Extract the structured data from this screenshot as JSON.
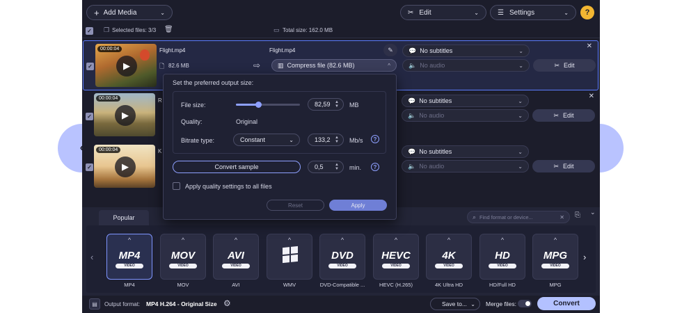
{
  "header": {
    "add_media": "Add Media",
    "edit": "Edit",
    "settings": "Settings",
    "help": "?"
  },
  "toolbar": {
    "selected_files": "Selected files: 3/3",
    "total_size": "Total size: 162.0 MB"
  },
  "files": [
    {
      "duration": "00:00:04",
      "name": "Flight.mp4",
      "size": "82.6 MB",
      "output_name": "Flight.mp4",
      "compress": "Compress file (82.6 MB)",
      "subtitles": "No subtitles",
      "audio": "No audio",
      "edit": "Edit"
    },
    {
      "duration": "00:00:04",
      "name": "R",
      "subtitles": "No subtitles",
      "audio": "No audio",
      "edit": "Edit"
    },
    {
      "duration": "00:00:04",
      "name": "K",
      "subtitles": "No subtitles",
      "audio": "No audio",
      "edit": "Edit"
    }
  ],
  "compress_popup": {
    "title": "Set the preferred output size:",
    "file_size_label": "File size:",
    "file_size_value": "82,59",
    "file_size_unit": "MB",
    "file_size_fraction": 0.35,
    "quality_label": "Quality:",
    "quality_value": "Original",
    "bitrate_label": "Bitrate type:",
    "bitrate_type": "Constant",
    "bitrate_value": "133,2",
    "bitrate_unit": "Mb/s",
    "convert_sample": "Convert sample",
    "sample_value": "0,5",
    "sample_unit": "min.",
    "apply_all": "Apply quality settings to all files",
    "reset": "Reset",
    "apply": "Apply"
  },
  "formats": {
    "tab_popular": "Popular",
    "search_placeholder": "Find format or device...",
    "items": [
      {
        "logo": "MP4",
        "label": "MP4"
      },
      {
        "logo": "MOV",
        "label": "MOV"
      },
      {
        "logo": "AVI",
        "label": "AVI"
      },
      {
        "logo": "WMV",
        "label": "WMV"
      },
      {
        "logo": "DVD",
        "label": "DVD-Compatible ..."
      },
      {
        "logo": "HEVC",
        "label": "HEVC (H.265)"
      },
      {
        "logo": "4K",
        "label": "4K Ultra HD"
      },
      {
        "logo": "HD",
        "label": "HD/Full HD"
      },
      {
        "logo": "MPG",
        "label": "MPG"
      }
    ]
  },
  "footer": {
    "output_format_label": "Output format:",
    "output_format_value": "MP4 H.264 - Original Size",
    "save_to": "Save to...",
    "merge_files": "Merge files:",
    "convert": "Convert"
  },
  "colors": {
    "accent": "#7f95ff",
    "convert_button": "#b3c1ff",
    "background": "#1c1d2b"
  }
}
